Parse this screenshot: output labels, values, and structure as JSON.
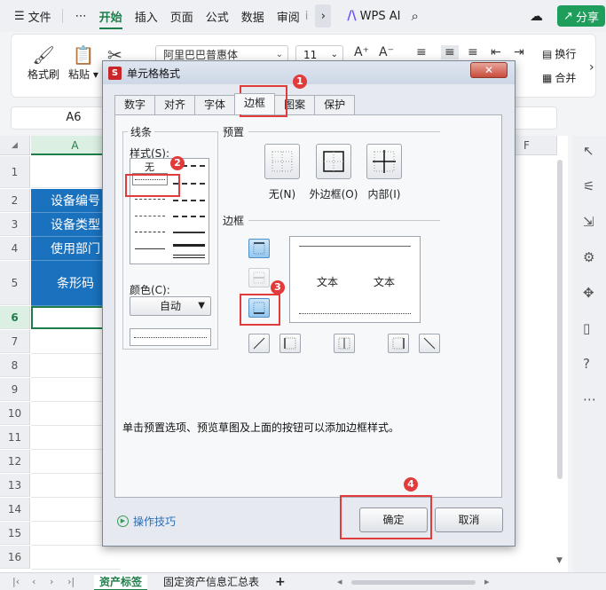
{
  "menu": {
    "file": "文件",
    "more": "⋯",
    "tabs": [
      "开始",
      "插入",
      "页面",
      "公式",
      "数据",
      "审阅",
      "ⅰ"
    ],
    "active_tab": "开始",
    "wps_ai": "WPS AI",
    "share": "分享"
  },
  "ribbon": {
    "format_painter": "格式刷",
    "paste": "粘贴",
    "font_name": "阿里巴巴普惠体",
    "font_size": "11",
    "wrap": "换行",
    "merge": "合并"
  },
  "formula_bar": {
    "name_box": "A6"
  },
  "sheet": {
    "col_headers": [
      "A",
      "F"
    ],
    "rows": [
      "1",
      "2",
      "3",
      "4",
      "5",
      "6",
      "7",
      "8",
      "9",
      "10",
      "11",
      "12",
      "13",
      "14",
      "15",
      "16"
    ],
    "cells": [
      "设备编号",
      "设备类型",
      "使用部门",
      "条形码"
    ]
  },
  "sheet_tabs": {
    "tabs": [
      "资产标签",
      "固定资产信息汇总表"
    ],
    "add": "+"
  },
  "dialog": {
    "title": "单元格格式",
    "close": "✕",
    "tabs": [
      "数字",
      "对齐",
      "字体",
      "边框",
      "图案",
      "保护"
    ],
    "active_tab": "边框",
    "line_group": "线条",
    "style_label": "样式(S):",
    "style_none": "无",
    "color_label": "颜色(C):",
    "color_value": "自动",
    "preset_group": "预置",
    "preset_none": "无(N)",
    "preset_outline": "外边框(O)",
    "preset_inside": "内部(I)",
    "border_group": "边框",
    "preview_text_1": "文本",
    "preview_text_2": "文本",
    "hint": "单击预置选项、预览草图及上面的按钮可以添加边框样式。",
    "tips": "操作技巧",
    "ok": "确定",
    "cancel": "取消"
  },
  "annotations": [
    "1",
    "2",
    "3",
    "4"
  ],
  "colors": {
    "accent": "#1e7e4a",
    "header_blue": "#1a71bd",
    "annotation_red": "#e23b3b"
  }
}
